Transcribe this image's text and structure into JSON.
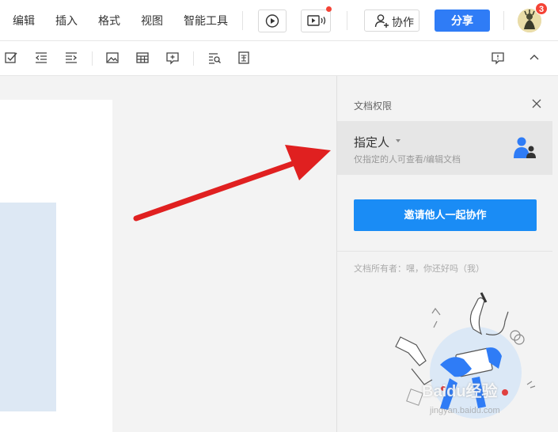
{
  "menu": {
    "items": [
      "编辑",
      "插入",
      "格式",
      "视图",
      "智能工具"
    ]
  },
  "header": {
    "collab_label": "协作",
    "share_label": "分享",
    "notification_count": "3"
  },
  "panel": {
    "title": "文档权限",
    "permission": {
      "title": "指定人",
      "description": "仅指定的人可查看/编辑文档"
    },
    "invite_label": "邀请他人一起协作",
    "owner_text": "文档所有者：嘿，你还好吗（我）"
  },
  "watermark": {
    "brand": "Baidu经验",
    "url": "jingyan.baidu.com"
  },
  "colors": {
    "accent": "#2f7cf6",
    "invite": "#1a8cf5",
    "arrow": "#e02020",
    "badge": "#f44336"
  }
}
